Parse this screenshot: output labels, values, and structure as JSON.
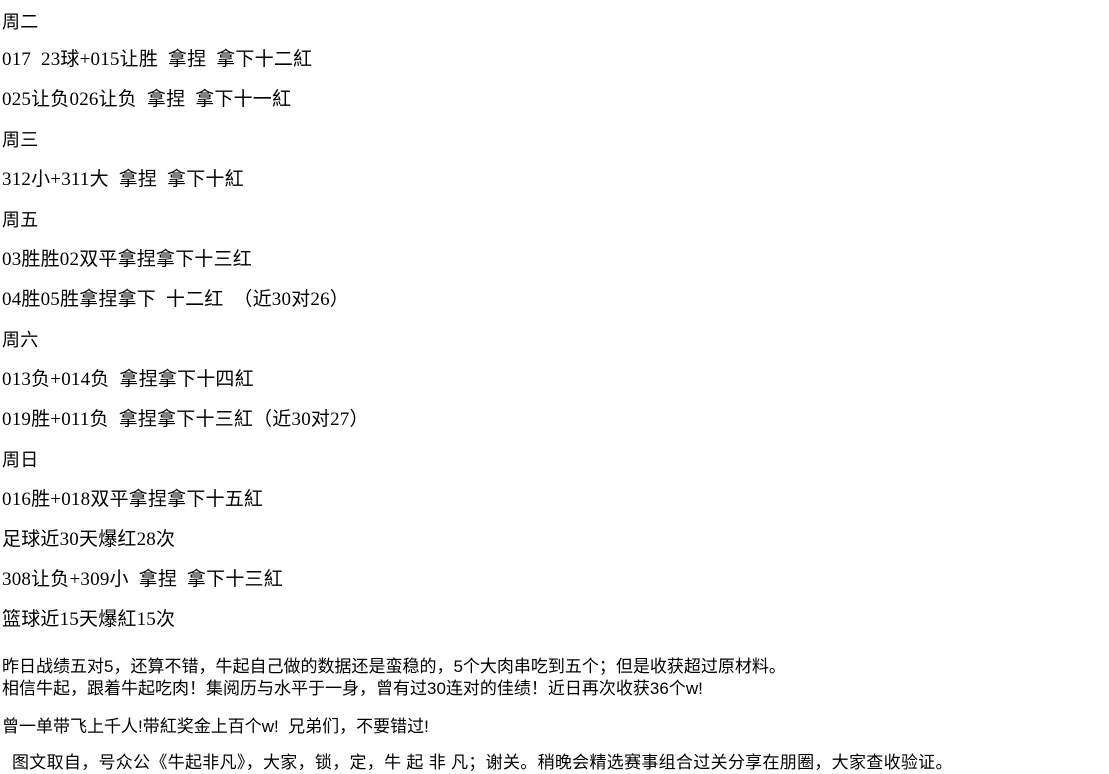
{
  "document": {
    "type": "text-post",
    "language": "zh-CN",
    "background_color": "#ffffff",
    "text_color": "#000000"
  },
  "tips": [
    {
      "id": "day-tuesday",
      "kind": "day",
      "text": "周二"
    },
    {
      "id": "tip-tue-1",
      "kind": "tip",
      "text": "017  23球+015让胜  拿捏  拿下十二紅"
    },
    {
      "id": "tip-tue-2",
      "kind": "tip",
      "text": "025让负026让负  拿捏  拿下十一紅"
    },
    {
      "id": "day-wednesday",
      "kind": "day",
      "text": "周三"
    },
    {
      "id": "tip-wed-1",
      "kind": "tip",
      "text": "312小+311大  拿捏  拿下十紅"
    },
    {
      "id": "day-friday",
      "kind": "day",
      "text": "周五"
    },
    {
      "id": "tip-fri-1",
      "kind": "tip",
      "text": "03胜胜02双平拿捏拿下十三红"
    },
    {
      "id": "tip-fri-2",
      "kind": "tip",
      "text": "04胜05胜拿捏拿下  十二红  （近30对26）"
    },
    {
      "id": "day-saturday",
      "kind": "day",
      "text": "周六"
    },
    {
      "id": "tip-sat-1",
      "kind": "tip",
      "text": "013负+014负  拿捏拿下十四紅"
    },
    {
      "id": "tip-sat-2",
      "kind": "tip",
      "text": "019胜+011负  拿捏拿下十三紅（近30对27）"
    },
    {
      "id": "day-sunday",
      "kind": "day",
      "text": "周日"
    },
    {
      "id": "tip-sun-1",
      "kind": "tip",
      "text": "016胜+018双平拿捏拿下十五紅"
    },
    {
      "id": "stat-football",
      "kind": "tip",
      "text": "足球近30天爆红28次"
    },
    {
      "id": "tip-basketball-1",
      "kind": "tip",
      "text": "308让负+309小  拿捏  拿下十三紅"
    },
    {
      "id": "stat-basketball",
      "kind": "tip",
      "text": "篮球近15天爆紅15次"
    }
  ],
  "promo": {
    "paragraph_1_line_1": "昨日战绩五对5，还算不错，牛起自己做的数据还是蛮稳的，5个大肉串吃到五个；但是收获超过原材料。",
    "paragraph_1_line_2": "相信牛起，跟着牛起吃肉！集阅历与水平于一身，曾有过30连对的佳绩！近日再次收获36个w!",
    "paragraph_2": "曾一单带飞上千人!带紅奖金上百个w!  兄弟们，不要错过!",
    "footer": "图文取自，号众公《牛起非凡》，大家，锁，定，牛 起 非 凡；谢关。稍晚会精选赛事组合过关分享在朋圈，大家查收验证。"
  }
}
